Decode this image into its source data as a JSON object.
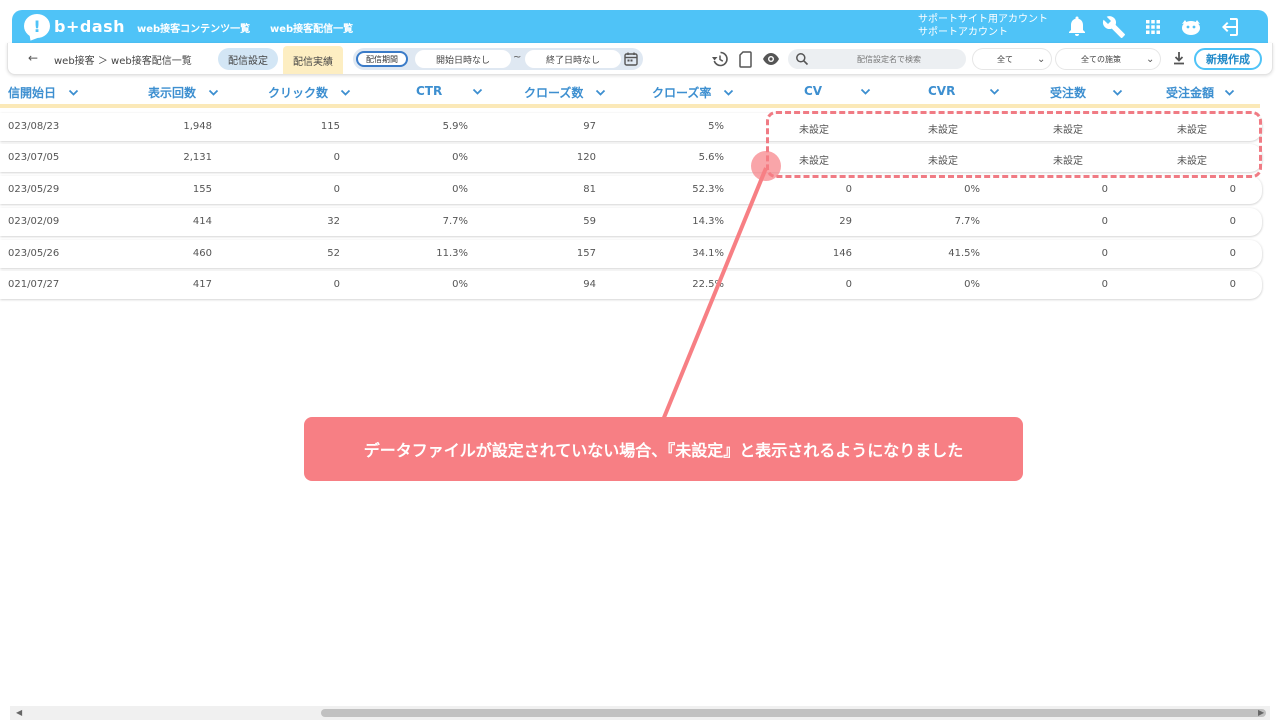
{
  "header": {
    "logo_text": "b+dash",
    "nav": [
      "web接客コンテンツ一覧",
      "web接客配信一覧"
    ],
    "account_line1": "サポートサイト用アカウント",
    "account_line2": "サポートアカウント"
  },
  "subbar": {
    "breadcrumb": "web接客 ＞ web接客配信一覧",
    "tab_settings": "配信設定",
    "tab_results": "配信実績",
    "period_label": "配信期間",
    "start_date": "開始日時なし",
    "end_date": "終了日時なし",
    "tilde": "~",
    "search_placeholder": "配信設定名で検索",
    "filter_all": "全て",
    "filter_measures": "全ての施策",
    "new_button": "新規作成"
  },
  "table": {
    "columns": [
      "信開始日",
      "表示回数",
      "クリック数",
      "CTR",
      "クローズ数",
      "クローズ率",
      "CV",
      "CVR",
      "受注数",
      "受注金額"
    ],
    "rows": [
      [
        "023/08/23",
        "1,948",
        "115",
        "5.9%",
        "97",
        "5%",
        "未設定",
        "未設定",
        "未設定",
        "未設定"
      ],
      [
        "023/07/05",
        "2,131",
        "0",
        "0%",
        "120",
        "5.6%",
        "未設定",
        "未設定",
        "未設定",
        "未設定"
      ],
      [
        "023/05/29",
        "155",
        "0",
        "0%",
        "81",
        "52.3%",
        "0",
        "0%",
        "0",
        "0"
      ],
      [
        "023/02/09",
        "414",
        "32",
        "7.7%",
        "59",
        "14.3%",
        "29",
        "7.7%",
        "0",
        "0"
      ],
      [
        "023/05/26",
        "460",
        "52",
        "11.3%",
        "157",
        "34.1%",
        "146",
        "41.5%",
        "0",
        "0"
      ],
      [
        "021/07/27",
        "417",
        "0",
        "0%",
        "94",
        "22.5%",
        "0",
        "0%",
        "0",
        "0"
      ]
    ]
  },
  "annotation": {
    "text": "データファイルが設定されていない場合、『未設定』と表示されるようになりました"
  },
  "colors": {
    "brand": "#4fc3f7",
    "header_text": "#3d8fd0",
    "annotation": "#f77f84"
  }
}
